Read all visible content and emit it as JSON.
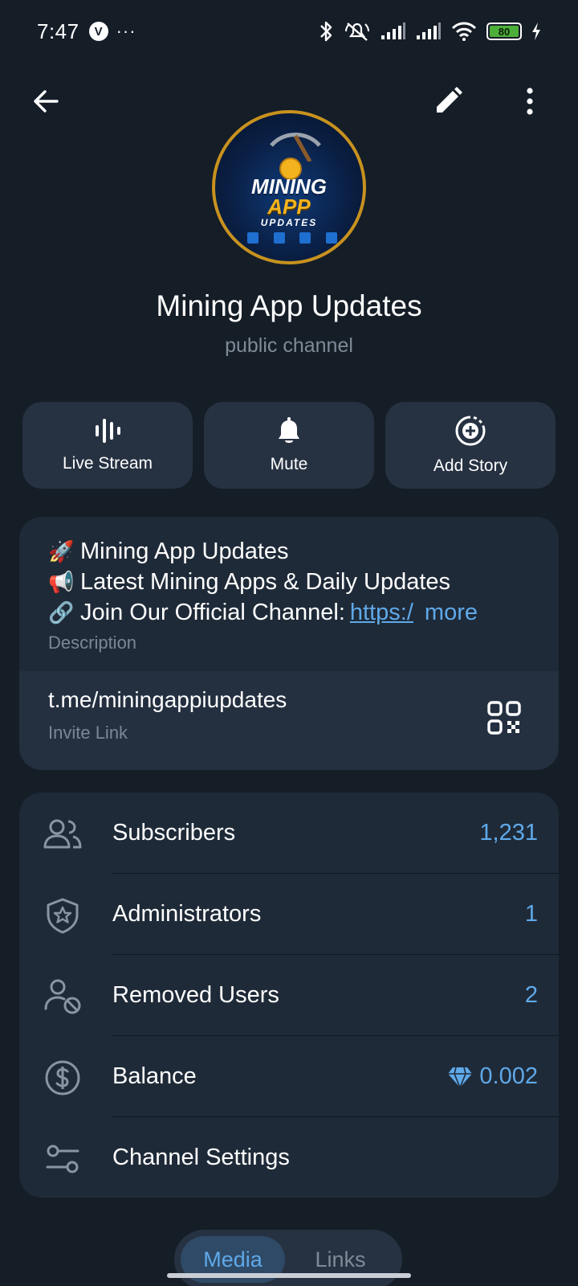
{
  "status_bar": {
    "time": "7:47",
    "vpn_badge": "V",
    "more": "···",
    "battery": "80",
    "icons": [
      "bluetooth-icon",
      "mute-icon",
      "signal-icon",
      "signal-icon",
      "wifi-icon",
      "battery-icon",
      "charging-icon"
    ]
  },
  "topbar": {
    "back_icon": "arrow-left-icon",
    "edit_icon": "pencil-icon",
    "menu_icon": "more-vert-icon"
  },
  "avatar": {
    "line1": "MINING",
    "line2": "APP",
    "line3": "UPDATES"
  },
  "channel": {
    "title": "Mining App Updates",
    "subtitle": "public channel"
  },
  "actions": [
    {
      "label": "Live Stream",
      "icon": "live-stream-icon"
    },
    {
      "label": "Mute",
      "icon": "bell-icon"
    },
    {
      "label": "Add Story",
      "icon": "add-story-icon"
    }
  ],
  "info": {
    "desc_line1_emoji": "🚀",
    "desc_line1": "Mining App Updates",
    "desc_line2_emoji": "📢",
    "desc_line2": "Latest Mining Apps & Daily Updates",
    "desc_line3_emoji": "🔗",
    "desc_line3": "Join Our Official Channel:",
    "desc_link": "https:/",
    "more": "more",
    "desc_caption": "Description",
    "invite_link": "t.me/miningappiupdates",
    "invite_caption": "Invite Link"
  },
  "stats": [
    {
      "label": "Subscribers",
      "value": "1,231",
      "icon": "people-icon"
    },
    {
      "label": "Administrators",
      "value": "1",
      "icon": "shield-star-icon"
    },
    {
      "label": "Removed Users",
      "value": "2",
      "icon": "user-blocked-icon"
    },
    {
      "label": "Balance",
      "value": "0.002",
      "icon": "dollar-circle-icon"
    },
    {
      "label": "Channel Settings",
      "value": "",
      "icon": "sliders-icon"
    }
  ],
  "tabs": {
    "media": "Media",
    "links": "Links"
  },
  "colors": {
    "background": "#151d27",
    "card": "#1f2a38",
    "accent": "#5fa9e9",
    "muted": "#7f8a97"
  }
}
